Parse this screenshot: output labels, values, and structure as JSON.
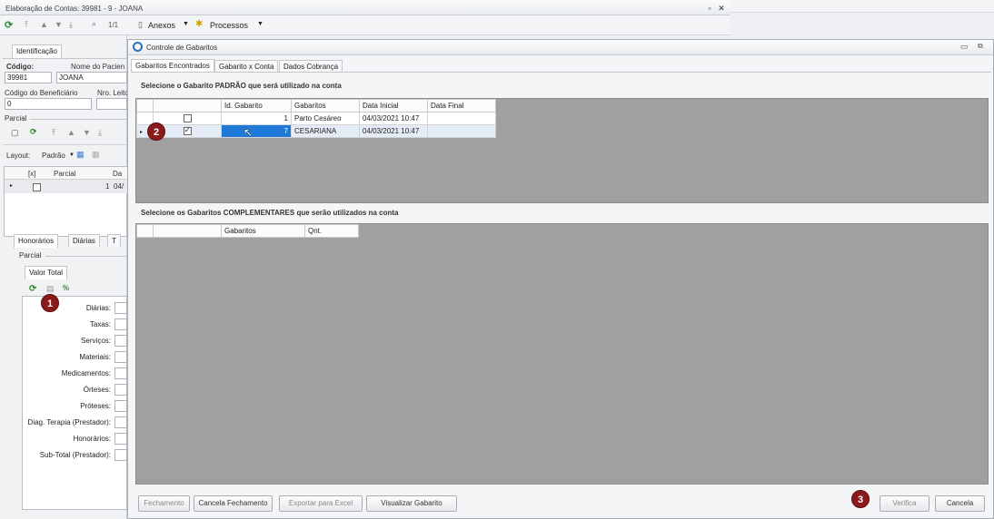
{
  "parent_window": {
    "title": "Elaboração de Contas: 39981 - 9 - JOANA",
    "pager": "1/1",
    "menu_anexos": "Anexos",
    "menu_processos": "Processos",
    "tab_identificacao": "Identificação",
    "codigo_label": "Código:",
    "codigo_value": "39981",
    "paciente_label": "Nome do Pacien",
    "paciente_value": "JOANA",
    "beneficiario_label": "Código do Beneficiário",
    "beneficiario_value": "0",
    "leito_label": "Nro. Leito",
    "parcial_label": "Parcial",
    "layout_label": "Layout:",
    "layout_value": "Padrão",
    "grid_col_x": "[x]",
    "grid_col_parcial": "Parcial",
    "grid_col_da": "Da",
    "grid_row_parcial": "1",
    "grid_row_da": "04/",
    "tabs_bottom": [
      "Honorários",
      "Diárias",
      "T"
    ],
    "parcial_section": "Parcial",
    "valor_total_tab": "Valor Total",
    "rows": [
      "Diárias:",
      "Taxas:",
      "Serviços:",
      "Materiais:",
      "Medicamentos:",
      "Órteses:",
      "Próteses:",
      "Diag. Terapia (Prestador):",
      "Honorários:",
      "Sub-Total (Prestador):"
    ]
  },
  "dialog": {
    "title": "Controle de Gabaritos",
    "tabs": [
      "Gabaritos Encontrados",
      "Gabarito x Conta",
      "Dados Cobrança"
    ],
    "section1_title": "Selecione o Gabarito PADRÃO que será utilizado na conta",
    "grid1": {
      "headers": [
        "",
        "Id. Gabarito",
        "Gabaritos",
        "Data Inicial",
        "Data Final"
      ],
      "rows": [
        {
          "checked": false,
          "id": "1",
          "gabarito": "Parto Cesáreo",
          "data_inicial": "04/03/2021 10:47",
          "data_final": ""
        },
        {
          "checked": true,
          "id": "7",
          "gabarito": "CESARIANA",
          "data_inicial": "04/03/2021 10:47",
          "data_final": ""
        }
      ]
    },
    "section2_title": "Selecione os Gabaritos COMPLEMENTARES que serão utilizados na conta",
    "grid2": {
      "headers": [
        "",
        "Gabaritos",
        "Qnt."
      ]
    },
    "buttons": {
      "fechamento": "Fechamento",
      "cancela_fechamento": "Cancela Fechamento",
      "exportar": "Exportar para Excel",
      "visualizar": "Visualizar Gabarito",
      "verifica": "Verifica",
      "cancela": "Cancela"
    }
  },
  "badges": [
    "1",
    "2",
    "3"
  ],
  "colors": {
    "badge": "#8b1a1a",
    "selection": "#1e7ad6",
    "grid_empty": "#a0a0a0"
  }
}
